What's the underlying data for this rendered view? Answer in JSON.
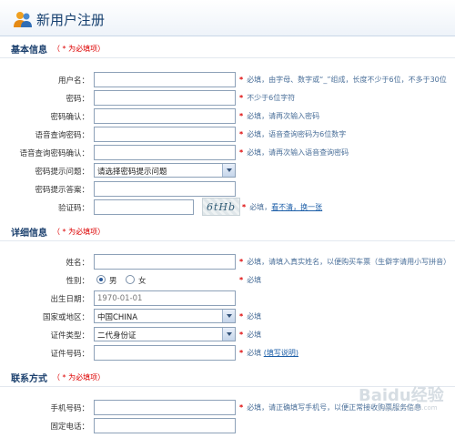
{
  "page": {
    "title": "新用户注册"
  },
  "basic": {
    "title": "基本信息",
    "required_note": "（ * 为必填项）",
    "rows": [
      {
        "label": "用户名：",
        "hint": "必填，由字母、数字或“_”组成，长度不少于6位，不多于30位"
      },
      {
        "label": "密码：",
        "hint": "不少于6位字符"
      },
      {
        "label": "密码确认：",
        "hint": "必填，请再次输入密码"
      },
      {
        "label": "语音查询密码：",
        "hint": "必填，语音查询密码为6位数字"
      },
      {
        "label": "语音查询密码确认：",
        "hint": "必填，请再次输入语音查询密码"
      },
      {
        "label": "密码提示问题：",
        "value": "请选择密码提示问题"
      },
      {
        "label": "密码提示答案："
      },
      {
        "label": "验证码：",
        "captcha": "6tHb",
        "hint": "必填，",
        "link": "看不清，换一张"
      }
    ]
  },
  "detail": {
    "title": "详细信息",
    "required_note": "（ * 为必填项）",
    "name": {
      "label": "姓名：",
      "hint": "必填，请填入真实姓名，以便购买车票（生僻字请用小写拼音）"
    },
    "gender": {
      "label": "性别：",
      "male": "男",
      "female": "女",
      "selected": "男",
      "hint": "必填"
    },
    "birth": {
      "label": "出生日期：",
      "value": "1970-01-01"
    },
    "country": {
      "label": "国家或地区：",
      "value": "中国CHINA",
      "hint": "必填"
    },
    "id_type": {
      "label": "证件类型：",
      "value": "二代身份证",
      "hint": "必填"
    },
    "id_no": {
      "label": "证件号码：",
      "hint": "必填",
      "link": "(填写说明)"
    }
  },
  "contact": {
    "title": "联系方式",
    "required_note": "（ * 为必填项）",
    "mobile": {
      "label": "手机号码：",
      "hint": "必填，请正确填写手机号，以便正常接收购票服务信息"
    },
    "phone": {
      "label": "固定电话："
    }
  },
  "watermark": {
    "text": "Baidu经验",
    "sub": "jingyan.baidu.com"
  }
}
